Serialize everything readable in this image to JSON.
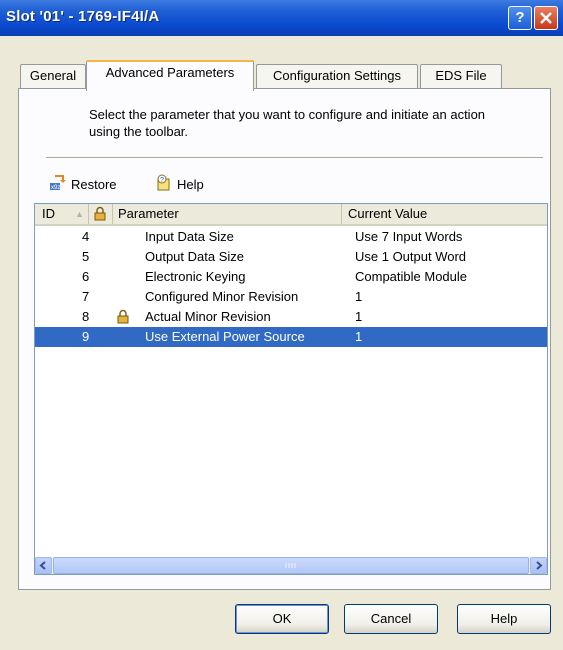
{
  "window": {
    "title": "Slot '01' - 1769-IF4I/A"
  },
  "tabs": [
    {
      "label": "General"
    },
    {
      "label": "Advanced Parameters"
    },
    {
      "label": "Configuration Settings"
    },
    {
      "label": "EDS File"
    }
  ],
  "instructions": "Select the parameter that you want to configure and initiate an action using the toolbar.",
  "toolbar": {
    "restore": "Restore",
    "help": "Help"
  },
  "table": {
    "columns": {
      "id": "ID",
      "parameter": "Parameter",
      "value": "Current Value"
    },
    "rows": [
      {
        "id": "4",
        "locked": false,
        "parameter": "Input Data Size",
        "value": "Use 7 Input Words"
      },
      {
        "id": "5",
        "locked": false,
        "parameter": "Output Data Size",
        "value": "Use 1 Output Word"
      },
      {
        "id": "6",
        "locked": false,
        "parameter": "Electronic Keying",
        "value": "Compatible Module"
      },
      {
        "id": "7",
        "locked": false,
        "parameter": "Configured Minor Revision",
        "value": "1"
      },
      {
        "id": "8",
        "locked": true,
        "parameter": "Actual Minor Revision",
        "value": "1"
      },
      {
        "id": "9",
        "locked": false,
        "parameter": "Use External Power Source",
        "value": "1",
        "selected": true
      }
    ]
  },
  "buttons": {
    "ok": "OK",
    "cancel": "Cancel",
    "help": "Help"
  }
}
